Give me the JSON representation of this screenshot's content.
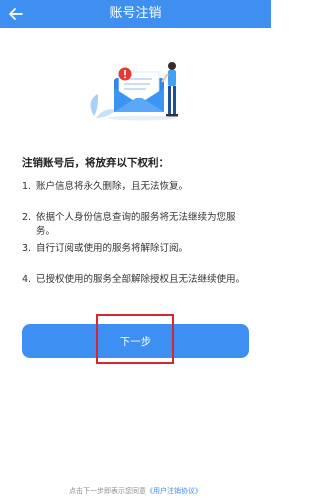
{
  "header": {
    "title": "账号注销",
    "background": "#3f8ff0",
    "back_icon": "arrow-left-icon"
  },
  "illustration": {
    "icon": "envelope-warning-illustration"
  },
  "content": {
    "heading": "注销账号后，将放弃以下权利：",
    "rights": [
      {
        "num": "1.",
        "text": "账户信息将永久删除，且无法恢复。"
      },
      {
        "num": "2.",
        "text": "依据个人身份信息查询的服务将无法继续为您服务。"
      },
      {
        "num": "3.",
        "text": "自行订阅或使用的服务将解除订阅。"
      },
      {
        "num": "4.",
        "text": "已授权使用的服务全部解除授权且无法继续使用。"
      }
    ]
  },
  "actions": {
    "next_label": "下一步",
    "button_color": "#3d8ff2",
    "highlight_color": "#d7262f"
  },
  "footer": {
    "prefix": "点击下一步即表示您同意",
    "link": "《用户注销协议》"
  }
}
